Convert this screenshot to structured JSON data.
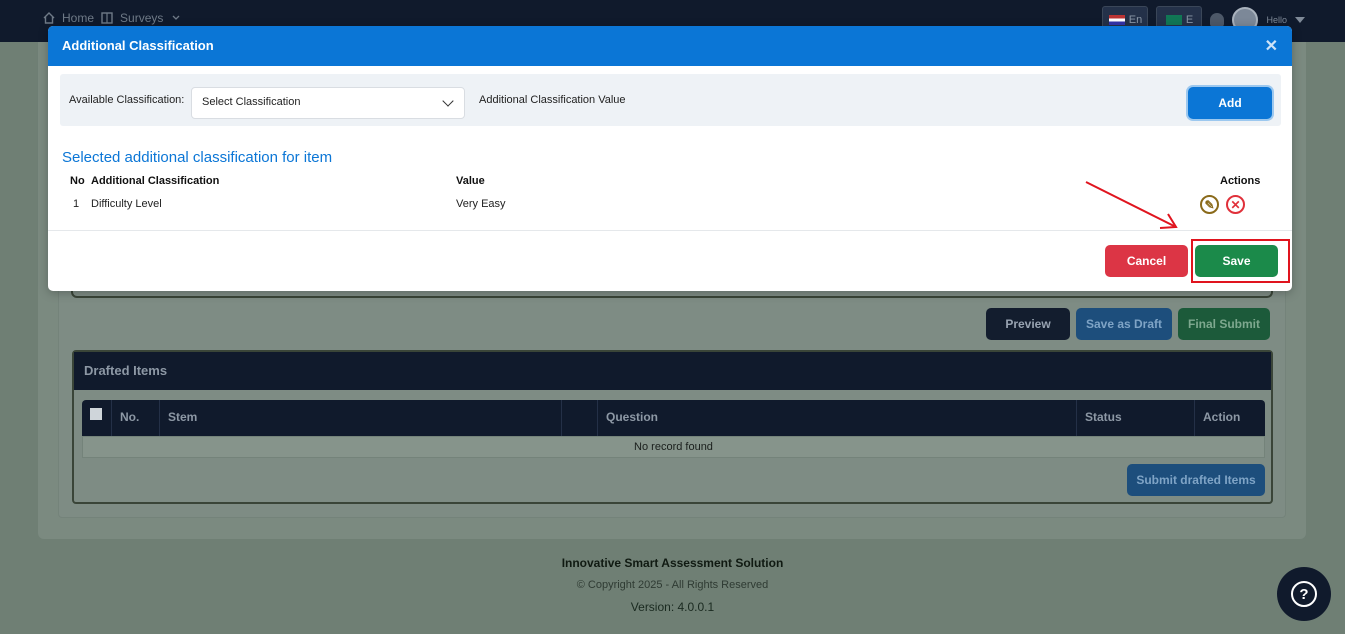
{
  "nav": {
    "home": "Home",
    "surveys": "Surveys"
  },
  "topbar": {
    "lang_en": "En",
    "lang_other": "E",
    "hello": "Hello"
  },
  "modal": {
    "title": "Additional Classification",
    "available_label": "Available Classification:",
    "select_value": "Select Classification",
    "value_label": "Additional Classification Value",
    "add_label": "Add",
    "selected_title": "Selected additional classification for item",
    "table": {
      "headers": [
        "No",
        "Additional Classification",
        "Value",
        "Actions"
      ],
      "rows": [
        {
          "no": "1",
          "classification": "Difficulty Level",
          "value": "Very Easy"
        }
      ]
    },
    "cancel_label": "Cancel",
    "save_label": "Save"
  },
  "actions": {
    "preview": "Preview",
    "save_draft": "Save as Draft",
    "final_submit": "Final Submit"
  },
  "drafted": {
    "title": "Drafted Items",
    "headers": [
      "No.",
      "Stem",
      "",
      "Question",
      "Status",
      "Action"
    ],
    "empty": "No record found",
    "submit_label": "Submit drafted Items"
  },
  "footer": {
    "product": "Innovative Smart Assessment Solution",
    "copyright": "© Copyright 2025 - All Rights Reserved",
    "version": "Version: 4.0.0.1"
  },
  "colors": {
    "primary": "#0b76d6",
    "danger": "#dc3545",
    "success": "#1b8a4a",
    "navy": "#101a2c",
    "annotation": "#e0141e"
  },
  "icons": {
    "help": "question-circle-icon",
    "edit": "pencil-icon",
    "delete": "close-circle-icon"
  }
}
